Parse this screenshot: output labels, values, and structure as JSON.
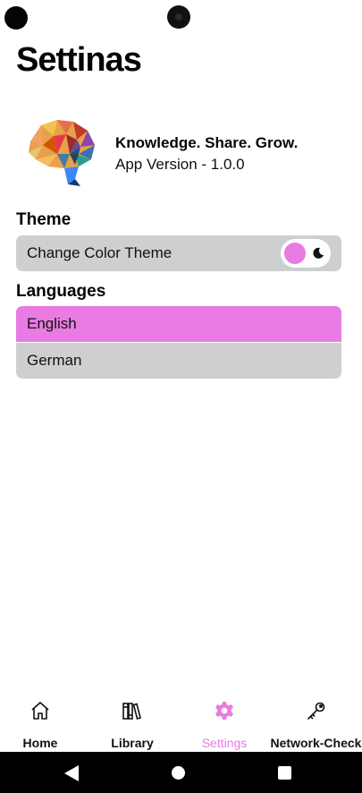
{
  "page": {
    "title": "Settinas"
  },
  "about": {
    "tagline": "Knowledge. Share. Grow.",
    "version": "App Version - 1.0.0",
    "logo_icon": "brain-logo-icon"
  },
  "theme": {
    "section_title": "Theme",
    "row_label": "Change Color Theme",
    "toggle_state": "light",
    "toggle_icon": "moon-icon"
  },
  "languages": {
    "section_title": "Languages",
    "items": [
      {
        "label": "English",
        "selected": true
      },
      {
        "label": "German",
        "selected": false
      }
    ]
  },
  "bottom_nav": {
    "items": [
      {
        "label": "Home",
        "icon": "home-icon",
        "active": false
      },
      {
        "label": "Library",
        "icon": "library-icon",
        "active": false
      },
      {
        "label": "Settings",
        "icon": "gear-icon",
        "active": true
      },
      {
        "label": "Network-Check",
        "icon": "key-icon",
        "active": false
      }
    ]
  },
  "colors": {
    "accent": "#e97be3",
    "row_background": "#cdcfd0",
    "text": "#111111",
    "system_nav": "#000000"
  }
}
